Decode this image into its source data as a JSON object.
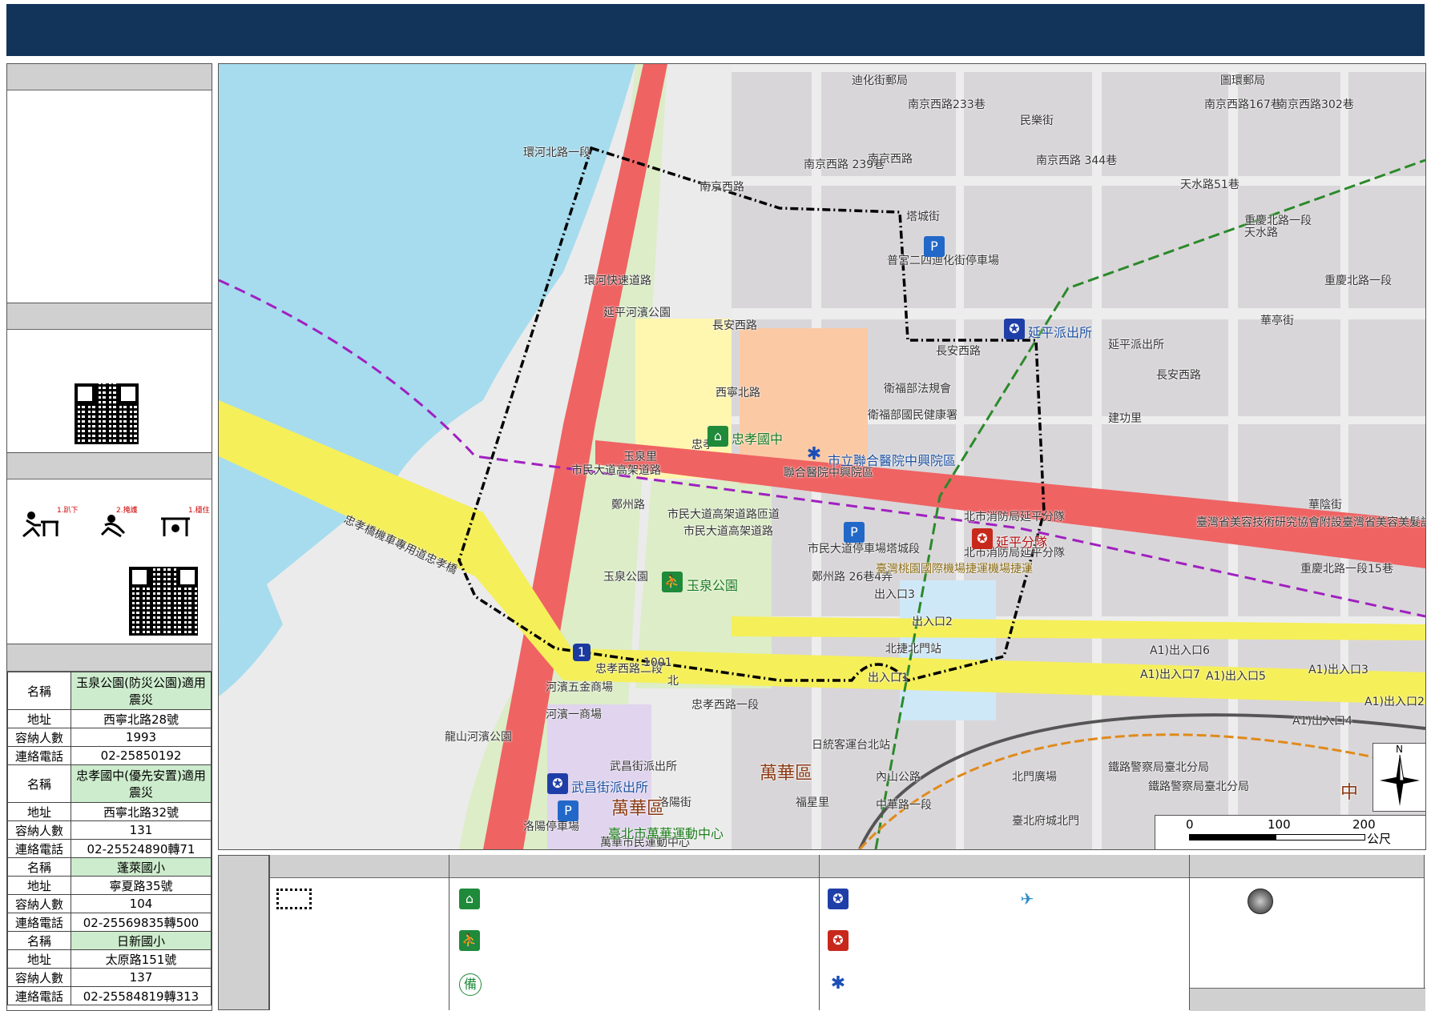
{
  "header": {
    "title": ""
  },
  "shelters": [
    {
      "name_label": "名稱",
      "name": "玉泉公園(防災公園)適用震災",
      "addr_label": "地址",
      "addr": "西寧北路28號",
      "cap_label": "容納人數",
      "cap": "1993",
      "tel_label": "連絡電話",
      "tel": "02-25850192"
    },
    {
      "name_label": "名稱",
      "name": "忠孝國中(優先安置)適用震災",
      "addr_label": "地址",
      "addr": "西寧北路32號",
      "cap_label": "容納人數",
      "cap": "131",
      "tel_label": "連絡電話",
      "tel": "02-25524890轉71"
    },
    {
      "name_label": "名稱",
      "name": "蓬萊國小",
      "addr_label": "地址",
      "addr": "寧夏路35號",
      "cap_label": "容納人數",
      "cap": "104",
      "tel_label": "連絡電話",
      "tel": "02-25569835轉500"
    },
    {
      "name_label": "名稱",
      "name": "日新國小",
      "addr_label": "地址",
      "addr": "太原路151號",
      "cap_label": "容納人數",
      "cap": "137",
      "tel_label": "連絡電話",
      "tel": "02-25584819轉313"
    }
  ],
  "drill": {
    "step1": "1.趴下",
    "step2": "2.掩護",
    "step3": "1.穩住"
  },
  "map": {
    "labels": {
      "nanjing_w": "南京西路",
      "nanjing_239": "南京西路 239巷",
      "nanjing_w2": "南京西路",
      "nanjing_233": "南京西路233巷",
      "nanjing_167": "南京西路167巷",
      "nanjing_302": "南京西路302巷",
      "nanjing_344": "南京西路 344巷",
      "minle": "民樂街",
      "tianshui": "天水路",
      "tianshui51": "天水路51巷",
      "tacheng": "塔城街",
      "chongqing": "重慶北路一段",
      "dihua_post": "迪化街郵局",
      "dihua_parking": "普宮二四迪化街停車場",
      "changan": "長安西路",
      "changan2": "長安西路",
      "changan3": "長安西路",
      "huanhe": "環河快速道路",
      "huanhe_n": "環河北路一段",
      "yanping_park": "延平河濱公園",
      "yuquan_li": "玉泉里",
      "zhongxiao_jh_small": "忠孝",
      "xining": "西寧北路",
      "mohw": "衛福部法規會",
      "nhi": "衛福部國民健康署",
      "hospital_small": "聯合醫院中興院區",
      "civic_elev": "市民大道高架道路",
      "civic_elev2": "市民大道高架道路匝道",
      "zhengzhou": "鄭州路",
      "civic_elev3": "市民大道高架道路",
      "civic_parking": "市民大道停車場塔城段",
      "zhengzhou26": "鄭州路 26巷4弄",
      "airport_mrt": "臺灣桃園國際機場捷運機場捷運",
      "exit3": "出入口3",
      "exit2": "出入口2",
      "exit1": "出入口1",
      "beimen_stn": "北捷北門站",
      "yuquan_park_small": "玉泉公園",
      "zhongxiao_bridge": "忠孝橋機車專用道忠孝橋",
      "zhongxiao_w": "忠孝西路二段",
      "zhongxiao_w1": "忠孝西路一段",
      "hehe_market": "河濱五金商場",
      "hehe_market2": "河濱一商場",
      "longshan_park": "龍山河濱公園",
      "wuchang_small": "武昌街派出所",
      "luoyang": "洛陽街",
      "luoyang_parking": "洛陽停車場",
      "wanhua_stadium_small": "萬華市民運動中心",
      "wanhua_dist2": "萬華區",
      "zhonghua": "中華路一段",
      "neishan": "內山公路",
      "fuxing_li": "福星里",
      "beimen": "北門廣場",
      "taipei_gate": "臺北府城北門",
      "railway": "鐵路警察局臺北分局",
      "railway2": "鐵路警察局臺北分局",
      "a1_6": "A1)出入口6",
      "a1_7": "A1)出入口7",
      "a1_5": "A1)出入口5",
      "a1_3": "A1)出入口3",
      "a1_2": "A1)出入口2",
      "a1_4": "A1)出入口4",
      "jiangong": "建功里",
      "huayin": "華陰街",
      "huating": "華亭街",
      "chongqing2": "重慶北路一段",
      "chongqing3": "重慶北路一段15巷",
      "beauty_school": "臺灣省美容技術研究協會附設臺灣省美容美髮訓練",
      "fire_small": "北市消防局延平分隊",
      "fire_small2": "北市消防局延平分隊",
      "taiyuan_bus": "日統客運台北站",
      "huanbei": "環河北路一段",
      "graph": "圖環郵局",
      "dihua_station": "延平派出所",
      "zhong": "中"
    },
    "pois": {
      "school": "忠孝國中",
      "hospital": "市立聯合醫院中興院區",
      "park": "玉泉公園",
      "police_yanping": "延平派出所",
      "fire_yanping": "延平分隊",
      "police_wuchang": "武昌街派出所",
      "stadium": "臺北市萬華運動中心",
      "wanhua_dist": "萬華區"
    },
    "scale": {
      "t0": "0",
      "t1": "100",
      "t2": "200",
      "unit": "公尺"
    },
    "compass": {
      "north": "N"
    },
    "highway": "1",
    "misc": {
      "num1001": "1001",
      "bei": "北"
    }
  },
  "legend": {
    "stock_glyph": "備"
  },
  "colors": {
    "header": "#12345a",
    "river": "#a6dcee",
    "park": "#dcedc8",
    "highway_red": "#ef6363",
    "highway_yellow": "#f5ef5a",
    "school_zone": "#fff6b0",
    "hospital_zone": "#fcc9a5"
  }
}
